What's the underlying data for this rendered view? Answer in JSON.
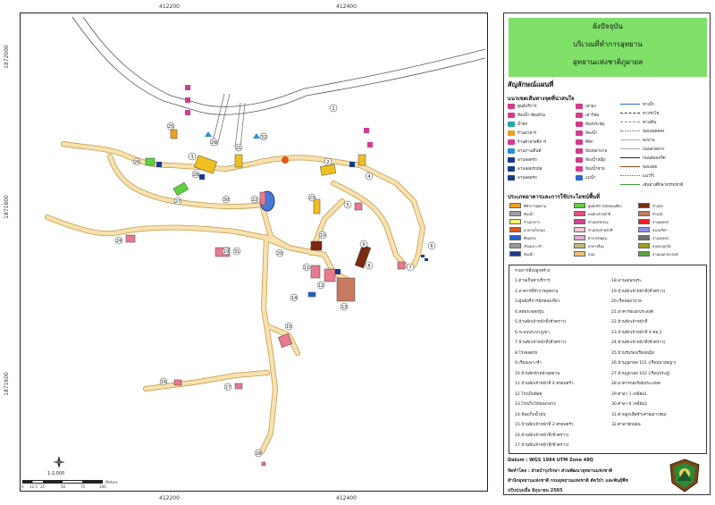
{
  "coords": {
    "x_top": [
      "412200",
      "412400"
    ],
    "x_bottom": [
      "412200",
      "412400"
    ],
    "y_left": [
      "1872000",
      "1871800",
      "1871600"
    ],
    "y_right": [
      "1872000",
      "1871800",
      "1871600"
    ]
  },
  "title": {
    "line1": "ผังปัจจุบัน",
    "line2": "บริเวณที่ทำการอุทยาน",
    "line3": "อุทยานแห่งชาติภูผายล"
  },
  "legend": {
    "heading": "สัญลักษณ์แผนที่",
    "sub_heading": "แนวเขตเส้นทางจุดที่น่าสนใจ",
    "col1": [
      {
        "label": "ศูนย์บริการ",
        "icon": "info-icon",
        "color": "#d23c8c"
      },
      {
        "label": "ห้องน้ำ-ห้องส้วม",
        "icon": "toilet-icon",
        "color": "#d23c8c"
      },
      {
        "label": "น้ำตก",
        "icon": "waterfall-icon",
        "color": "#22aaaa"
      },
      {
        "label": "ร้านอาหาร",
        "icon": "restaurant-icon",
        "color": "#e8a020"
      },
      {
        "label": "ร้านค้าสวัสดิการ",
        "icon": "shop-icon",
        "color": "#d23c8c"
      },
      {
        "label": "ลานกางเต็นท์",
        "icon": "tent-icon",
        "color": "#2a90d0"
      },
      {
        "label": "ลานจอดรถ",
        "icon": "parking-icon",
        "color": "#1a3a8a"
      },
      {
        "label": "ลานจอดรถบัส",
        "icon": "bus-icon",
        "color": "#1a3a8a"
      },
      {
        "label": "ลานจอดรถ",
        "icon": "car-icon",
        "color": "#1a3a8a"
      }
    ],
    "col2": [
      {
        "label": "เสาธง",
        "icon": "flag-icon",
        "color": "#d23c8c"
      },
      {
        "label": "เสาวิทยุ",
        "icon": "antenna-icon",
        "color": "#d23c8c"
      },
      {
        "label": "ห้องประชุม",
        "icon": "meeting-icon",
        "color": "#d23c8c"
      },
      {
        "label": "ห้องน้ำ",
        "icon": "wc-icon",
        "color": "#d23c8c"
      },
      {
        "label": "ที่พัก",
        "icon": "lodge-icon",
        "color": "#d23c8c"
      },
      {
        "label": "ห้องพยาบาล",
        "icon": "firstaid-icon",
        "color": "#d23c8c"
      },
      {
        "label": "ห้องน้ำหญิง",
        "icon": "female-icon",
        "color": "#d23c8c"
      },
      {
        "label": "ห้องน้ำชาย",
        "icon": "male-icon",
        "color": "#d23c8c"
      },
      {
        "label": "แม่น้ำ",
        "icon": "pond-icon",
        "color": "#2a6ad0"
      }
    ],
    "col3": [
      {
        "label": "ทางน้ำ",
        "style": "line-blue"
      },
      {
        "label": "ทางรถไฟ",
        "style": "line-rail"
      },
      {
        "label": "ทางเดิน",
        "style": "line-dash"
      },
      {
        "label": "ขอบเขตคลัง",
        "style": "line-dot"
      },
      {
        "label": "สะพาน",
        "style": "line-gray"
      },
      {
        "label": "ถนนลาดยาง",
        "style": "line-gray"
      },
      {
        "label": "ถนนคอนกรีต",
        "style": "line-black"
      },
      {
        "label": "ขอบเขต",
        "style": "line-brown"
      },
      {
        "label": "แนวรั้ว",
        "style": "line-dot"
      },
      {
        "label": "เส้นทางศึกษาธรรมชาติ",
        "style": "line-green"
      }
    ],
    "landuse_heading": "ประเภทอาคารและการใช้ประโยชน์พื้นที่",
    "landuse": [
      {
        "label": "ที่ทำการอุทยาน",
        "color": "#f0a020"
      },
      {
        "label": "ศูนย์บริการนักท่องเที่ยว",
        "color": "#60d040"
      },
      {
        "label": "บ้านพัก",
        "color": "#7a2a10"
      },
      {
        "label": "ห้องน้ำ",
        "color": "#a0a0a0"
      },
      {
        "label": "หอพักเจ้าหน้าที่",
        "color": "#e84a80"
      },
      {
        "label": "บ้านไม้",
        "color": "#c87a60"
      },
      {
        "label": "ร้านอาหาร",
        "color": "#f4f070"
      },
      {
        "label": "บ้านพักรับรอง",
        "color": "#d04090"
      },
      {
        "label": "ลานจอดรถ",
        "color": "#f02020"
      },
      {
        "label": "อาคารเก็บของ",
        "color": "#e05818"
      },
      {
        "label": "บ้านพักเจ้าหน้าที่",
        "color": "#f6c8d0"
      },
      {
        "label": "สนามกีฬา",
        "color": "#9090f0"
      },
      {
        "label": "ที่จอดรถ",
        "color": "#2060d0"
      },
      {
        "label": "ศาลาพักผ่อน",
        "color": "#e8a8d8"
      },
      {
        "label": "ลานจอดรถ",
        "color": "#707070"
      },
      {
        "label": "เรือนเพาะชำ",
        "color": "#9a9a9a"
      },
      {
        "label": "อาคารอื่นๆ",
        "color": "#c8b878"
      },
      {
        "label": "แปลงปลูกไม้",
        "color": "#a0a020"
      },
      {
        "label": "ห้องน้ำ",
        "color": "#1a3a8a"
      },
      {
        "label": "ถนน",
        "color": "#f2c070"
      },
      {
        "label": "ลานเอนกประสงค์",
        "color": "#60a040"
      }
    ]
  },
  "buildings": {
    "heading": "รายการสิ่งปลูกสร้าง",
    "left": [
      "1.ด่านเก็บค่าบริการ",
      "2.อาคารที่ทำการอุทยาน",
      "3.ศูนย์บริการนักท่องเที่ยว",
      "4.หอพระพุทธรูป",
      "5.บ้านพักเจ้าหน้าที่(ชั่วคราว)",
      "6.ระบบประปาภูเขา",
      "7.บ้านพักเจ้าหน้าที่(ชั่วคราว)",
      "8.โรงจอดรถ",
      "9.เรือนเพาะชำ",
      "10.บ้านพักหัวหน้าอุทยาน",
      "11.บ้านพักเจ้าหน้าที่ 4 ครอบครัว",
      "12.โรงเก็บพัสดุ",
      "13.โรงเก็บไม้ของกลาง",
      "14.ห้องเก็บน้ำมัน",
      "15.บ้านพักเจ้าหน้าที่ 2 ครอบครัว",
      "16.บ้านพักเจ้าหน้าที่(ชั่วคราว)",
      "17.บ้านพักเจ้าหน้าที่(ชั่วคราว)"
    ],
    "right": [
      "18.ลานเอนกอุระ",
      "19.บ้านพักเจ้าหน้าที่(ชั่วคราว)",
      "20.เรือนพยาบาล",
      "21.อาคารอเนกประสงค์",
      "22.บ้านพักเจ้าหน้าที่",
      "23.บ้านพักเจ้าหน้าที่ 4 คห 2",
      "24.บ้านพักเจ้าหน้าที่(ชั่วคราว)",
      "25.บ้านรับรองเรือนหญิง",
      "26.บ้านภูผายล 101 (เรือนนางพญา)",
      "27.บ้านภูผายล 102 (เรือนประดู่)",
      "28.อาคารกองร้อยประเภทค",
      "29.ศาลา 1 เหลี่ยม1",
      "30.ศาลา 6 เหลี่ยม2",
      "31.ค่ายลูกเสือซ้า(ค่ายเยาวชน)",
      "32.ศาลาพักผ่อน"
    ]
  },
  "footer": {
    "datum": "Datum : WGS 1984 UTM Zone 48Q",
    "made_by": "จัดทำโดย : ฝ่ายบำรุงรักษา ส่วนพัฒนาอุทยานแห่งชาติ",
    "office": "สำนักอุทยานแห่งชาติ กรมอุทยานแห่งชาติ สัตว์ป่า และพันธุ์พืช",
    "date": "ปรับปรุงเมื่อ มิถุนายน 2565"
  },
  "scale": {
    "ratio": "1:2,000",
    "ticks": [
      "0",
      "12.5",
      "25",
      "50",
      "75",
      "100"
    ],
    "unit": "Meters"
  },
  "map_labels": [
    "1",
    "2",
    "3",
    "4",
    "5",
    "6",
    "7",
    "8",
    "9",
    "10",
    "11",
    "12",
    "13",
    "14",
    "15",
    "16",
    "17",
    "18",
    "19",
    "20",
    "21",
    "22",
    "23",
    "24",
    "25",
    "26",
    "27",
    "28",
    "29",
    "30",
    "31",
    "32"
  ],
  "colors": {
    "road": "#f2c77a",
    "road_edge": "#c79a4a",
    "title_bg": "#7fe06a"
  }
}
